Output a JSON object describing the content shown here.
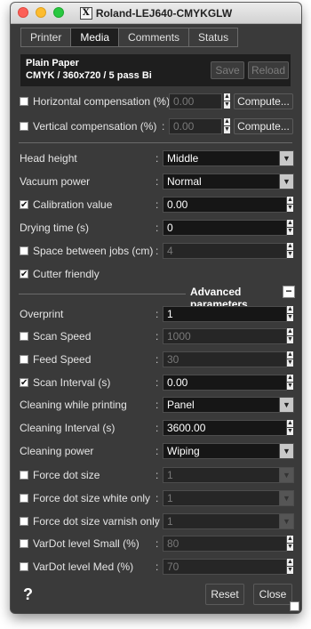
{
  "window": {
    "title": "Roland-LEJ640-CMYKGLW",
    "app_icon": "X"
  },
  "tabs": [
    {
      "label": "Printer"
    },
    {
      "label": "Media"
    },
    {
      "label": "Comments"
    },
    {
      "label": "Status"
    }
  ],
  "media": {
    "name": "Plain Paper",
    "mode": "CMYK / 360x720 / 5 pass Bi",
    "save_label": "Save",
    "reload_label": "Reload"
  },
  "compensation": {
    "horizontal": {
      "label": "Horizontal compensation (%)",
      "value": "0.00",
      "button": "Compute..."
    },
    "vertical": {
      "label": "Vertical compensation (%)",
      "value": "0.00",
      "button": "Compute..."
    }
  },
  "settings": {
    "head_height": {
      "label": "Head height",
      "value": "Middle"
    },
    "vacuum_power": {
      "label": "Vacuum power",
      "value": "Normal"
    },
    "calibration_value": {
      "label": "Calibration value",
      "value": "0.00",
      "check": "✔"
    },
    "drying_time": {
      "label": "Drying time (s)",
      "value": "0"
    },
    "space_between_jobs": {
      "label": "Space between jobs (cm)",
      "value": "4"
    },
    "cutter_friendly": {
      "label": "Cutter friendly",
      "check": "✔"
    }
  },
  "advanced": {
    "header_label": "Advanced parameters",
    "toggle_symbol": "−",
    "overprint": {
      "label": "Overprint",
      "value": "1"
    },
    "scan_speed": {
      "label": "Scan Speed",
      "value": "1000"
    },
    "feed_speed": {
      "label": "Feed Speed",
      "value": "30"
    },
    "scan_interval": {
      "label": "Scan Interval (s)",
      "value": "0.00",
      "check": "✔"
    },
    "cleaning_while_printing": {
      "label": "Cleaning while printing",
      "value": "Panel"
    },
    "cleaning_interval": {
      "label": "Cleaning Interval (s)",
      "value": "3600.00"
    },
    "cleaning_power": {
      "label": "Cleaning power",
      "value": "Wiping"
    },
    "force_dot_size": {
      "label": "Force dot size",
      "value": "1"
    },
    "force_dot_size_white": {
      "label": "Force dot size white only",
      "value": "1"
    },
    "force_dot_size_varnish": {
      "label": "Force dot size varnish only",
      "value": "1"
    },
    "vardot_small": {
      "label": "VarDot level Small (%)",
      "value": "80"
    },
    "vardot_med": {
      "label": "VarDot level Med (%)",
      "value": "70"
    }
  },
  "footer": {
    "help": "?",
    "reset_label": "Reset",
    "close_label": "Close"
  },
  "common": {
    "colon": ":",
    "spin_up": "▲",
    "spin_down": "▼",
    "dropdown_arrow": "▼"
  }
}
